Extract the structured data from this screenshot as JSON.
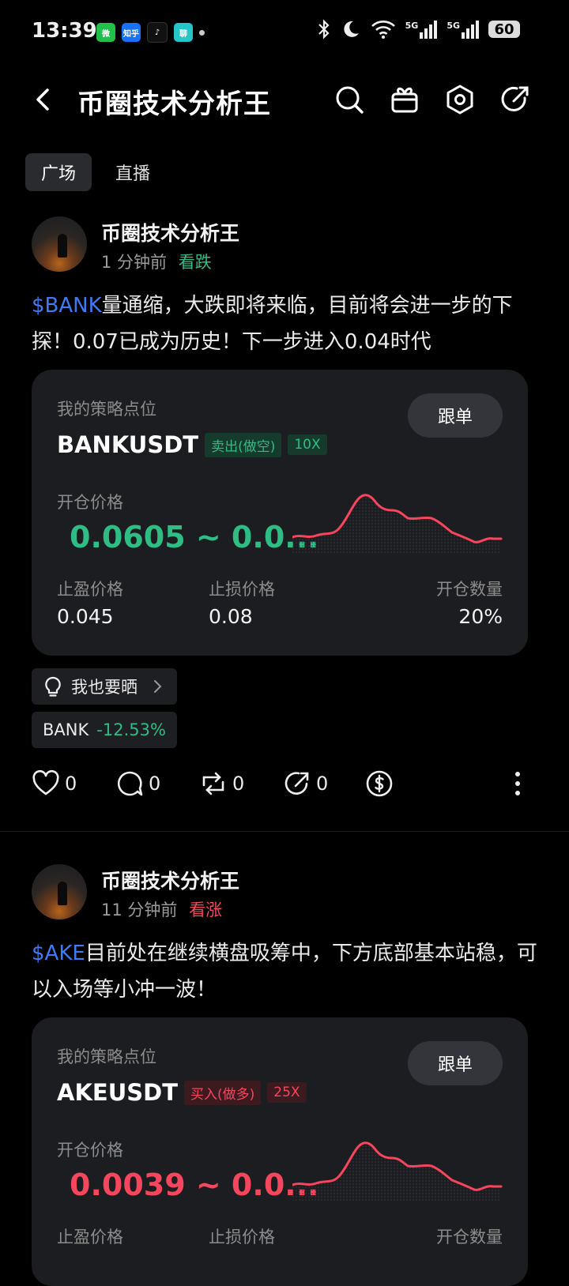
{
  "status": {
    "time": "13:39",
    "apps": [
      {
        "name": "wechat-app-icon",
        "color": "#20c04a",
        "label": "微"
      },
      {
        "name": "zhihu-app-icon",
        "color": "#1772f6",
        "label": "知乎"
      },
      {
        "name": "tiktok-app-icon",
        "color": "#111111",
        "label": "♪"
      },
      {
        "name": "misc-app-icon",
        "color": "#25c6c9",
        "label": "聊"
      }
    ],
    "signal_1": "5G",
    "signal_2": "5G",
    "battery": "60"
  },
  "header": {
    "title": "币圈技术分析王"
  },
  "tabs": [
    {
      "label": "广场"
    },
    {
      "label": "直播"
    }
  ],
  "posts": [
    {
      "author": "币圈技术分析王",
      "time": "1 分钟前",
      "sentiment": "看跌",
      "ticker": "$BANK",
      "text": "量通缩，大跌即将来临，目前将会进一步的下探！0.07已成为历史！下一步进入0.04时代",
      "card": {
        "label": "我的策略点位",
        "pair": "BANKUSDT",
        "side": "卖出(做空)",
        "leverage": "10X",
        "follow": "跟单",
        "entry_label": "开仓价格",
        "entry": "0.0605 ~ 0.0...",
        "tp_label": "止盈价格",
        "tp": "0.045",
        "sl_label": "止损价格",
        "sl": "0.08",
        "qty_label": "开仓数量",
        "qty": "20%"
      },
      "share": "我也要晒",
      "chip_symbol": "BANK",
      "chip_change": "-12.53%",
      "likes": "0",
      "comments": "0",
      "reposts": "0",
      "shares": "0"
    },
    {
      "author": "币圈技术分析王",
      "time": "11 分钟前",
      "sentiment": "看涨",
      "ticker": "$AKE",
      "text": "目前处在继续横盘吸筹中，下方底部基本站稳，可以入场等小冲一波！",
      "card": {
        "label": "我的策略点位",
        "pair": "AKEUSDT",
        "side": "买入(做多)",
        "leverage": "25X",
        "follow": "跟单",
        "entry_label": "开仓价格",
        "entry": "0.0039 ~ 0.0...",
        "tp_label": "止盈价格",
        "sl_label": "止损价格",
        "qty_label": "开仓数量"
      }
    }
  ],
  "colors": {
    "up": "#f6465d",
    "down": "#2ebd85",
    "link": "#3d7bf5"
  }
}
